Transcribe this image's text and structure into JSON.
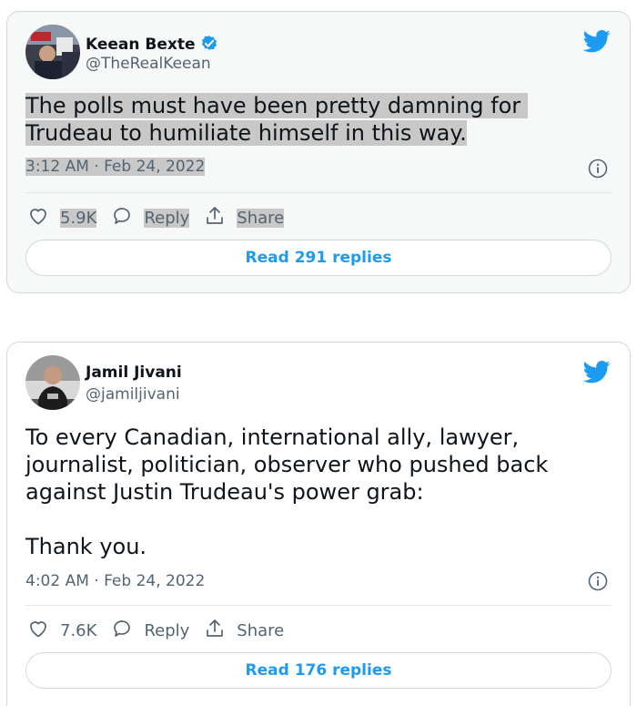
{
  "colors": {
    "accent": "#1d9bf0",
    "verified": "#1d9bf0",
    "muted": "#536471",
    "highlight": "#c8c8c8"
  },
  "tweets": [
    {
      "author": {
        "name": "Keean Bexte",
        "handle": "@TheRealKeean",
        "verified": true
      },
      "text": "The polls must have been pretty damning for Trudeau to humiliate himself in this way.",
      "timestamp": "3:12 AM · Feb 24, 2022",
      "actions": {
        "likes": "5.9K",
        "reply": "Reply",
        "share": "Share"
      },
      "read_replies": "Read 291 replies",
      "icons": [
        "avatar",
        "verified-badge-icon",
        "twitter-bird-icon",
        "info-icon",
        "heart-icon",
        "reply-bubble-icon",
        "share-icon"
      ]
    },
    {
      "author": {
        "name": "Jamil Jivani",
        "handle": "@jamiljivani",
        "verified": false
      },
      "text": "To every Canadian, international ally, lawyer, journalist, politician, observer who pushed back against Justin Trudeau's power grab:\n\nThank you.",
      "timestamp": "4:02 AM · Feb 24, 2022",
      "actions": {
        "likes": "7.6K",
        "reply": "Reply",
        "share": "Share"
      },
      "read_replies": "Read 176 replies",
      "icons": [
        "avatar",
        "twitter-bird-icon",
        "info-icon",
        "heart-icon",
        "reply-bubble-icon",
        "share-icon"
      ]
    }
  ]
}
